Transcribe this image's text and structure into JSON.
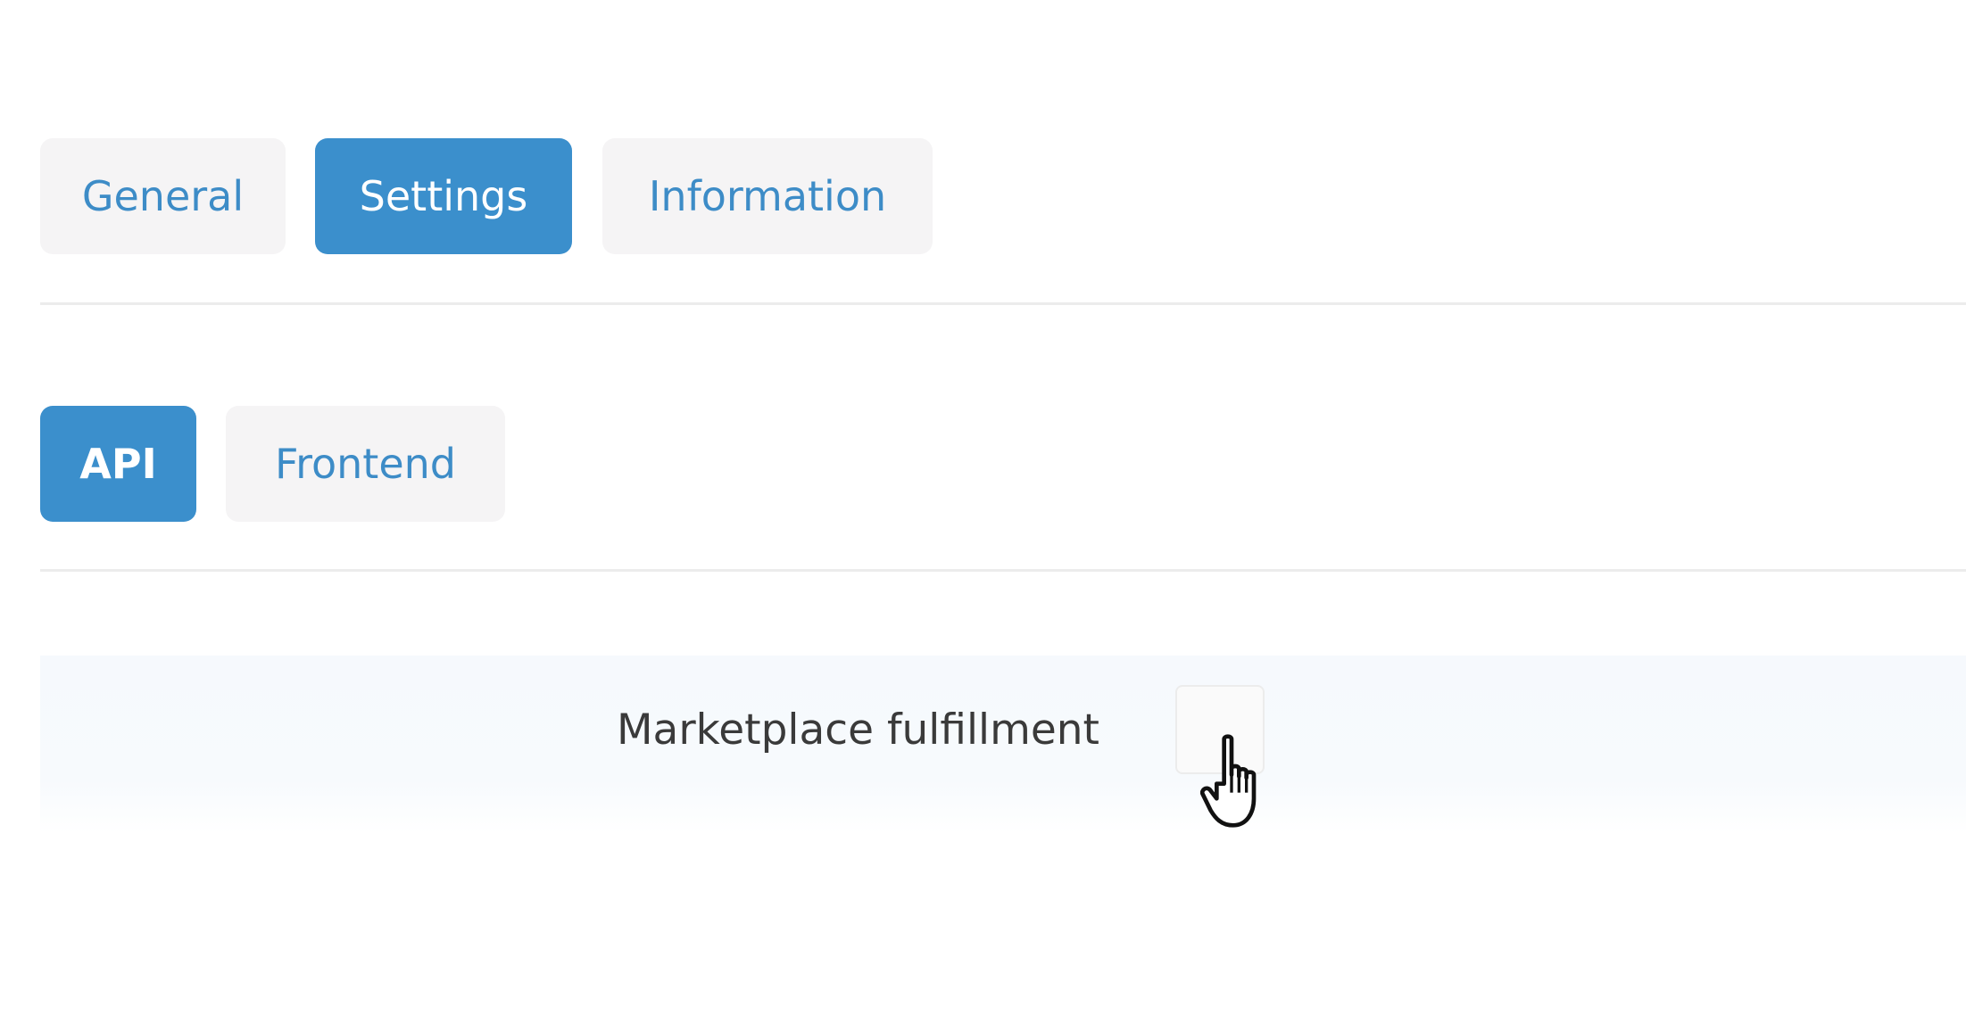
{
  "tabs": {
    "primary": [
      {
        "label": "General",
        "active": false
      },
      {
        "label": "Settings",
        "active": true
      },
      {
        "label": "Information",
        "active": false
      }
    ],
    "secondary": [
      {
        "label": "API",
        "active": true
      },
      {
        "label": "Frontend",
        "active": false
      }
    ]
  },
  "form": {
    "marketplace_fulfillment": {
      "label": "Marketplace fulfillment",
      "checked": false
    }
  },
  "colors": {
    "accent": "#3b8fcc",
    "tab_inactive_bg": "#f5f4f5",
    "tab_inactive_text": "#3d8cc7"
  },
  "icons": {
    "cursor": "hand-pointer-icon"
  }
}
